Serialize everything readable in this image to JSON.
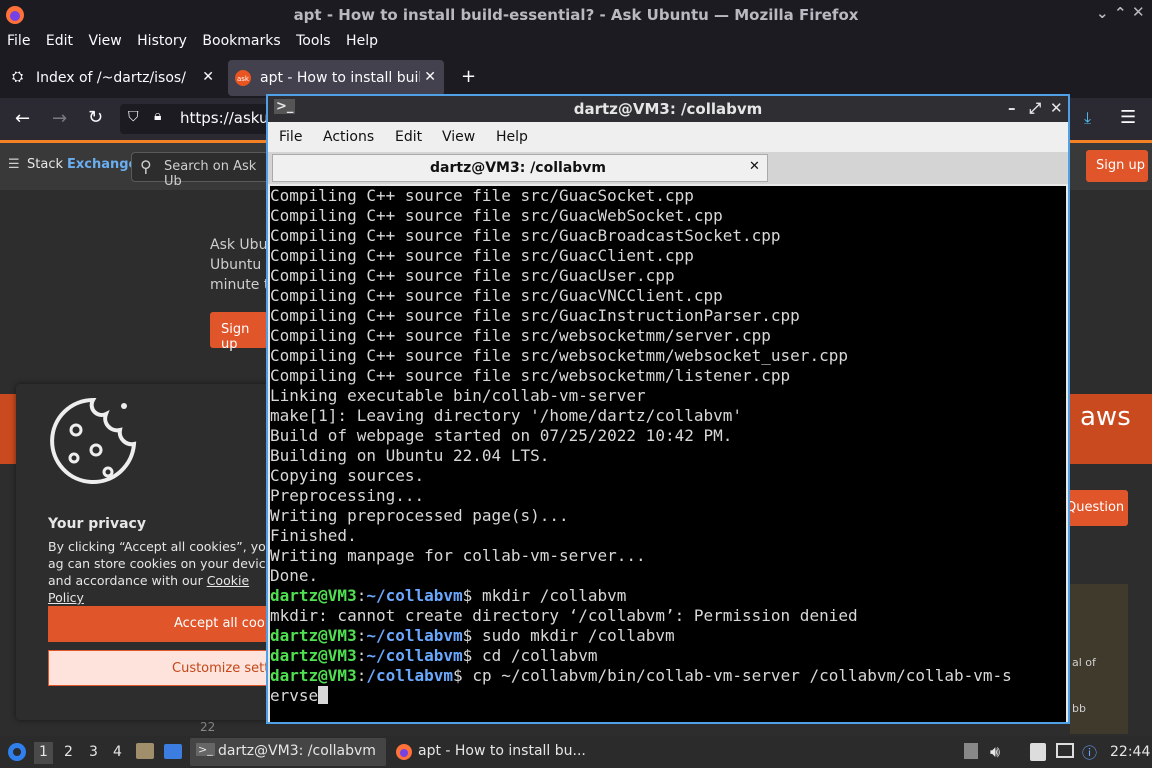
{
  "firefox": {
    "window_title": "apt - How to install build-essential? - Ask Ubuntu — Mozilla Firefox",
    "menu": [
      "File",
      "Edit",
      "View",
      "History",
      "Bookmarks",
      "Tools",
      "Help"
    ],
    "tabs": [
      {
        "label": "Index of /~dartz/isos/",
        "active": false
      },
      {
        "label": "apt - How to install build",
        "active": true
      }
    ],
    "url": "https://askul"
  },
  "page": {
    "logo_stack": "Stack",
    "logo_exchange": "Exchange",
    "search_placeholder": "Search on Ask Ub",
    "signup": "Sign up",
    "hero_text_1": "Ask Ubun",
    "hero_text_2": "Ubuntu u",
    "hero_text_3": "minute to",
    "hero_signup": "Sign up",
    "aws": "aws",
    "ask_question": "Question",
    "side_text_1": "al of",
    "side_text_2": "bb",
    "vote_num": "22"
  },
  "cookie": {
    "title": "Your privacy",
    "body": "By clicking “Accept all cookies”, you ag can store cookies on your device and accordance with our ",
    "policy_link": "Cookie Policy",
    "accept": "Accept all cooki",
    "customize": "Customize settin"
  },
  "terminal": {
    "window_title": "dartz@VM3: /collabvm",
    "menu": [
      "File",
      "Actions",
      "Edit",
      "View",
      "Help"
    ],
    "tab_label": "dartz@VM3: /collabvm",
    "output_lines": [
      "Compiling C++ source file src/GuacSocket.cpp",
      "Compiling C++ source file src/GuacWebSocket.cpp",
      "Compiling C++ source file src/GuacBroadcastSocket.cpp",
      "Compiling C++ source file src/GuacClient.cpp",
      "Compiling C++ source file src/GuacUser.cpp",
      "Compiling C++ source file src/GuacVNCClient.cpp",
      "Compiling C++ source file src/GuacInstructionParser.cpp",
      "Compiling C++ source file src/websocketmm/server.cpp",
      "Compiling C++ source file src/websocketmm/websocket_user.cpp",
      "Compiling C++ source file src/websocketmm/listener.cpp",
      "Linking executable bin/collab-vm-server",
      "make[1]: Leaving directory '/home/dartz/collabvm'",
      "Build of webpage started on 07/25/2022 10:42 PM.",
      "Building on Ubuntu 22.04 LTS.",
      "Copying sources.",
      "Preprocessing...",
      "Writing preprocessed page(s)...",
      "Finished.",
      "Writing manpage for collab-vm-server...",
      "Done."
    ],
    "prompt_user": "dartz@VM3",
    "commands": [
      {
        "dir": "~/collabvm",
        "cmd": "mkdir /collabvm"
      },
      {
        "error": "mkdir: cannot create directory ‘/collabvm’: Permission denied"
      },
      {
        "dir": "~/collabvm",
        "cmd": "sudo mkdir /collabvm"
      },
      {
        "dir": "~/collabvm",
        "cmd": "cd /collabvm"
      },
      {
        "dir": "/collabvm",
        "cmd": "cp ~/collabvm/bin/collab-vm-server /collabvm/collab-vm-s"
      }
    ],
    "wrap_line": "ervse"
  },
  "taskbar": {
    "workspaces": [
      "1",
      "2",
      "3",
      "4"
    ],
    "task_terminal": "dartz@VM3: /collabvm",
    "task_firefox": "apt - How to install bu...",
    "clock": "22:44"
  }
}
